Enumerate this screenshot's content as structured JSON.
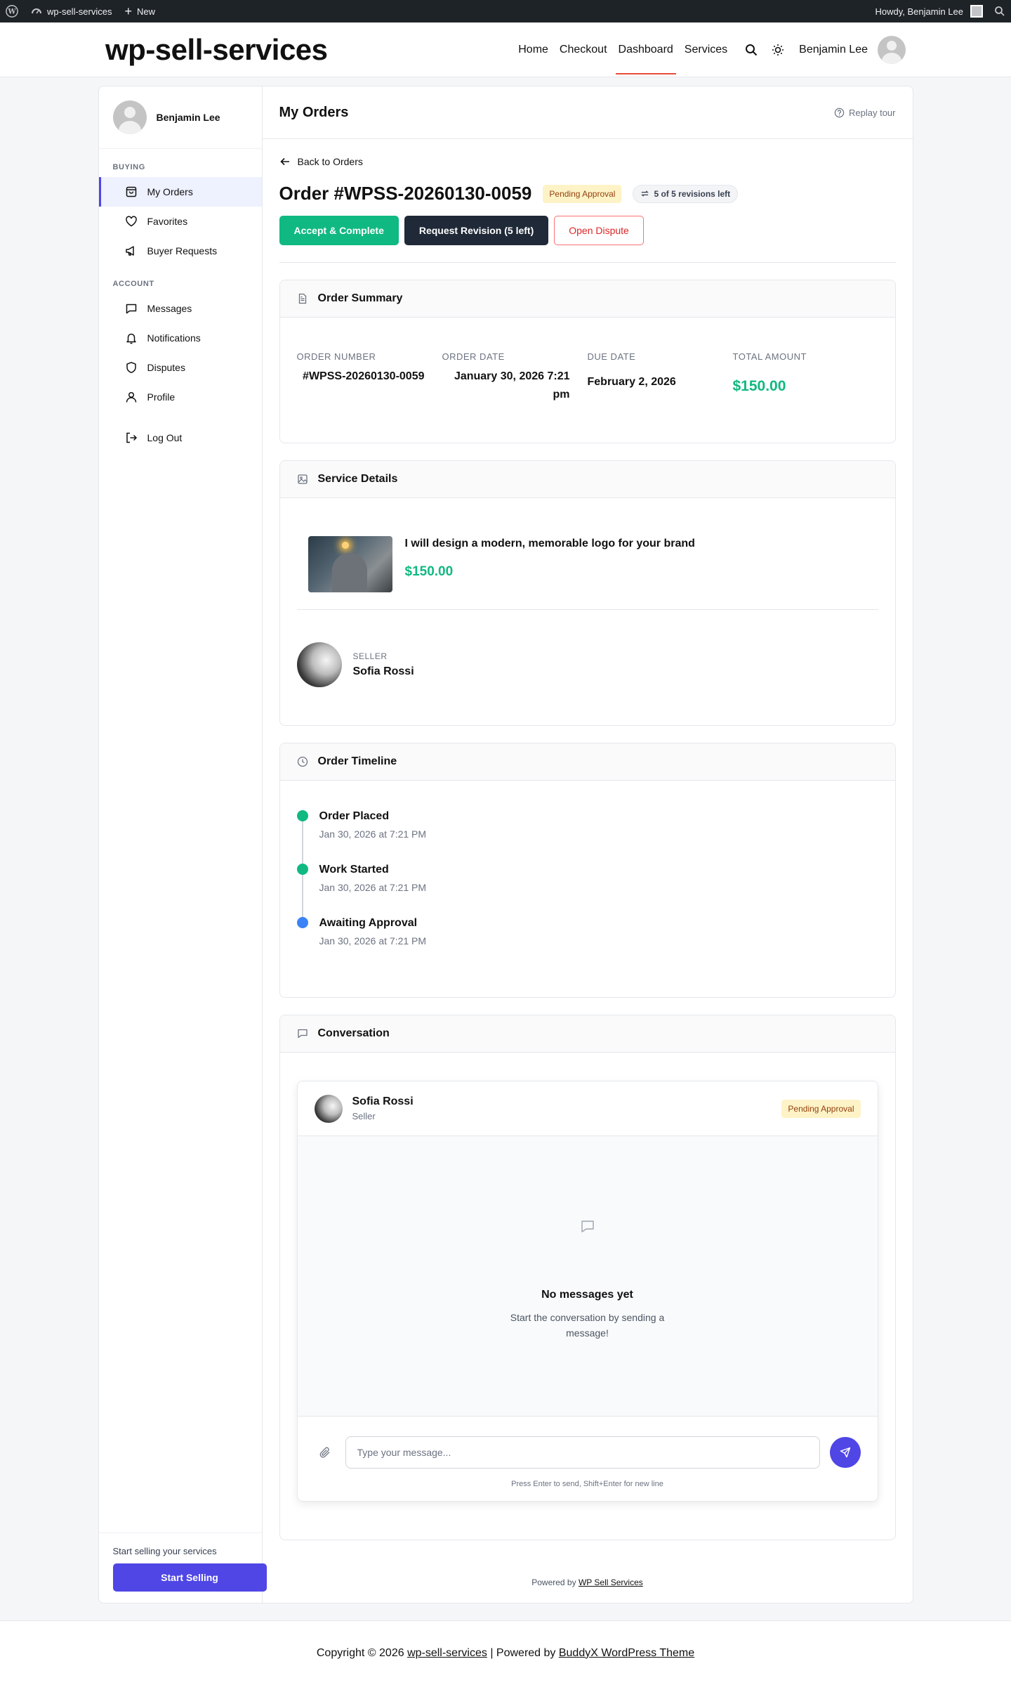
{
  "adminbar": {
    "site_name": "wp-sell-services",
    "new_label": "New",
    "howdy": "Howdy, Benjamin Lee"
  },
  "header": {
    "site_title": "wp-sell-services",
    "nav": [
      "Home",
      "Checkout",
      "Dashboard",
      "Services"
    ],
    "active_nav": "Dashboard",
    "user_name": "Benjamin Lee"
  },
  "sidebar": {
    "user_name": "Benjamin Lee",
    "section_buying": "BUYING",
    "buying_items": [
      "My Orders",
      "Favorites",
      "Buyer Requests"
    ],
    "section_account": "ACCOUNT",
    "account_items": [
      "Messages",
      "Notifications",
      "Disputes",
      "Profile"
    ],
    "logout": "Log Out",
    "bottom_text": "Start selling your services",
    "start_selling": "Start Selling"
  },
  "main": {
    "title": "My Orders",
    "replay_tour": "Replay tour",
    "back_link": "Back to Orders",
    "order_title": "Order #WPSS-20260130-0059",
    "status_badge": "Pending Approval",
    "revisions_badge": "5 of 5 revisions left",
    "actions": {
      "accept": "Accept & Complete",
      "revision": "Request Revision (5 left)",
      "dispute": "Open Dispute"
    }
  },
  "summary": {
    "title": "Order Summary",
    "order_number_label": "ORDER NUMBER",
    "order_number": "#WPSS-20260130-0059",
    "order_date_label": "ORDER DATE",
    "order_date": "January 30, 2026 7:21 pm",
    "due_date_label": "DUE DATE",
    "due_date": "February 2, 2026",
    "total_label": "TOTAL AMOUNT",
    "total": "$150.00"
  },
  "service": {
    "title": "Service Details",
    "name": "I will design a modern, memorable logo for your brand",
    "price": "$150.00",
    "seller_label": "SELLER",
    "seller_name": "Sofia Rossi"
  },
  "timeline": {
    "title": "Order Timeline",
    "events": [
      {
        "title": "Order Placed",
        "date": "Jan 30, 2026 at 7:21 PM",
        "color": "#10b981"
      },
      {
        "title": "Work Started",
        "date": "Jan 30, 2026 at 7:21 PM",
        "color": "#10b981"
      },
      {
        "title": "Awaiting Approval",
        "date": "Jan 30, 2026 at 7:21 PM",
        "color": "#3b82f6"
      }
    ]
  },
  "conversation": {
    "title": "Conversation",
    "contact_name": "Sofia Rossi",
    "contact_role": "Seller",
    "status": "Pending Approval",
    "empty_title": "No messages yet",
    "empty_sub": "Start the conversation by sending a message!",
    "input_placeholder": "Type your message...",
    "hint": "Press Enter to send, Shift+Enter for new line"
  },
  "powered": {
    "prefix": "Powered by",
    "link": "WP Sell Services"
  },
  "footer": {
    "copyright": "Copyright © 2026",
    "site_link": "wp-sell-services",
    "sep": "| Powered by",
    "theme_link": "BuddyX WordPress Theme"
  },
  "colors": {
    "accent": "#4f46e5",
    "success": "#10b981",
    "danger": "#dc2626",
    "pending_bg": "#fef3c7"
  }
}
